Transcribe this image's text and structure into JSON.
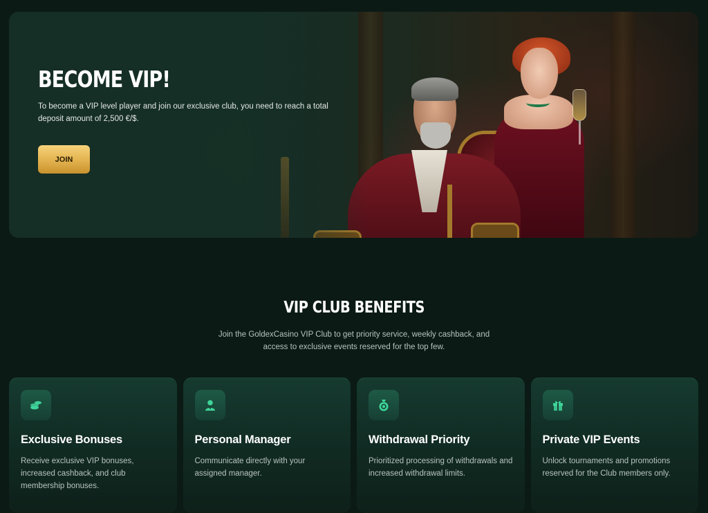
{
  "hero": {
    "title": "BECOME VIP!",
    "description": "To become a VIP level player and join our exclusive club, you need to reach a total deposit amount of 2,500 €/$.",
    "join_label": "JOIN"
  },
  "benefits": {
    "title": "VIP CLUB BENEFITS",
    "description": "Join the GoldexCasino VIP Club to get priority service, weekly cashback, and access to exclusive events reserved for the top few.",
    "cards": [
      {
        "icon": "coins-icon",
        "title": "Exclusive Bonuses",
        "text": "Receive exclusive VIP bonuses, increased cashback, and club membership bonuses."
      },
      {
        "icon": "manager-icon",
        "title": "Personal Manager",
        "text": "Communicate directly with your assigned manager."
      },
      {
        "icon": "money-bag-icon",
        "title": "Withdrawal Priority",
        "text": "Prioritized processing of withdrawals and increased withdrawal limits."
      },
      {
        "icon": "gift-icon",
        "title": "Private VIP Events",
        "text": "Unlock tournaments and promotions reserved for the Club members only."
      }
    ]
  },
  "colors": {
    "page_bg": "#0b1a15",
    "accent_gold": "#e2b24e",
    "icon_green": "#3fd49a",
    "card_bg": "#163a2f"
  }
}
